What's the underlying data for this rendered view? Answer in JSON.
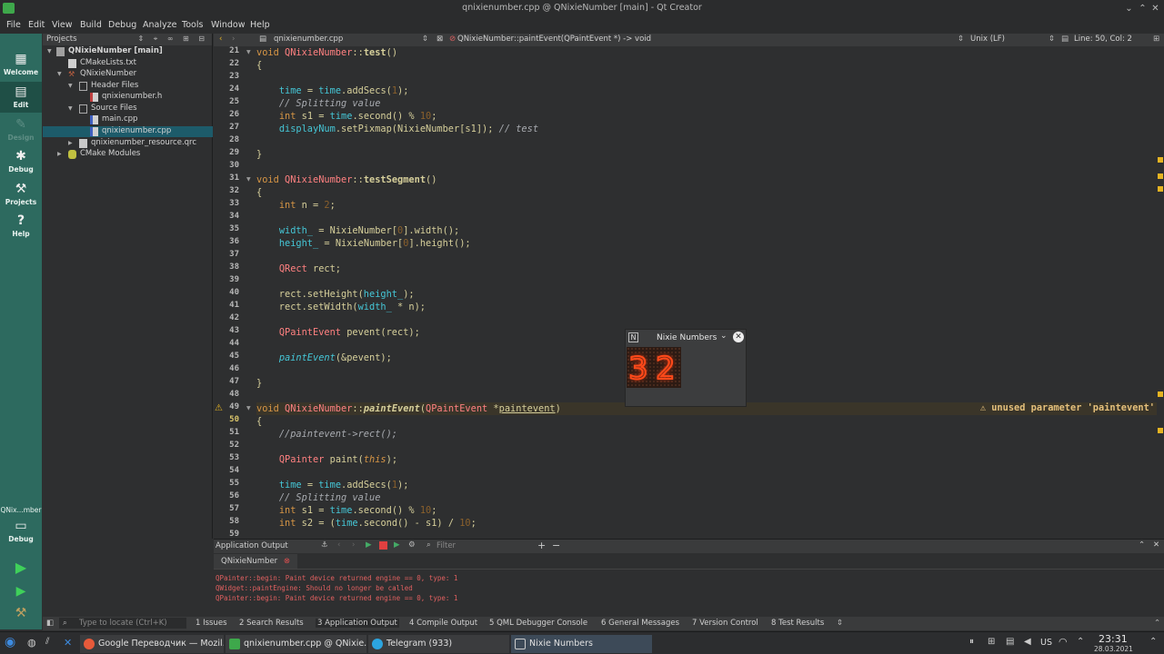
{
  "window": {
    "title": "qnixienumber.cpp @ QNixieNumber [main] - Qt Creator"
  },
  "menu": [
    "File",
    "Edit",
    "View",
    "Build",
    "Debug",
    "Analyze",
    "Tools",
    "Window",
    "Help"
  ],
  "modes": [
    {
      "label": "Welcome",
      "icon": "grid-icon"
    },
    {
      "label": "Edit",
      "icon": "document-icon"
    },
    {
      "label": "Design",
      "icon": "pencil-icon"
    },
    {
      "label": "Debug",
      "icon": "bug-icon"
    },
    {
      "label": "Projects",
      "icon": "wrench-icon"
    },
    {
      "label": "Help",
      "icon": "help-icon"
    }
  ],
  "kit": {
    "project": "QNix...mber",
    "label": "Debug"
  },
  "sidebar": {
    "title": "Projects",
    "tree": [
      {
        "label": "QNixieNumber [main]",
        "level": 0
      },
      {
        "label": "CMakeLists.txt",
        "level": 1
      },
      {
        "label": "QNixieNumber",
        "level": 1
      },
      {
        "label": "Header Files",
        "level": 2
      },
      {
        "label": "qnixienumber.h",
        "level": 3
      },
      {
        "label": "Source Files",
        "level": 2
      },
      {
        "label": "main.cpp",
        "level": 3
      },
      {
        "label": "qnixienumber.cpp",
        "level": 3
      },
      {
        "label": "qnixienumber_resource.qrc",
        "level": 2
      },
      {
        "label": "CMake Modules",
        "level": 1
      }
    ]
  },
  "editor": {
    "file": "qnixienumber.cpp",
    "symbol": "QNixieNumber::paintEvent(QPaintEvent *) -> void",
    "line_ending": "Unix (LF)",
    "position": "Line: 50, Col: 2",
    "line_numbers": [
      "21",
      "22",
      "23",
      "24",
      "25",
      "26",
      "27",
      "28",
      "29",
      "30",
      "31",
      "32",
      "33",
      "34",
      "35",
      "36",
      "37",
      "38",
      "39",
      "40",
      "41",
      "42",
      "43",
      "44",
      "45",
      "46",
      "47",
      "48",
      "49",
      "50",
      "51",
      "52",
      "53",
      "54",
      "55",
      "56",
      "57",
      "58",
      "59"
    ],
    "warning": "unused parameter 'paintevent'"
  },
  "output": {
    "title": "Application Output",
    "filter_placeholder": "Filter",
    "tab": "QNixieNumber",
    "lines": [
      "QPainter::begin: Paint device returned engine == 0, type: 1",
      "QWidget::paintEngine: Should no longer be called",
      "QPainter::begin: Paint device returned engine == 0, type: 1"
    ]
  },
  "status": {
    "locate_placeholder": "Type to locate (Ctrl+K)",
    "tabs": [
      "1  Issues",
      "2  Search Results",
      "3  Application Output",
      "4  Compile Output",
      "5  QML Debugger Console",
      "6  General Messages",
      "7  Version Control",
      "8  Test Results"
    ]
  },
  "popup": {
    "title": "Nixie Numbers",
    "digit1": "3",
    "digit2": "2"
  },
  "taskbar": {
    "windows": [
      "Google Переводчик — Mozil...",
      "qnixienumber.cpp @ QNixie...",
      "Telegram (933)",
      "Nixie Numbers"
    ],
    "kbd": "US",
    "time": "23:31",
    "date": "28.03.2021"
  },
  "colors": {
    "accent": "#2d6a5f",
    "keyword": "#d69545",
    "type": "#ff8080",
    "member": "#45c6d6",
    "error_text": "#e06060"
  }
}
